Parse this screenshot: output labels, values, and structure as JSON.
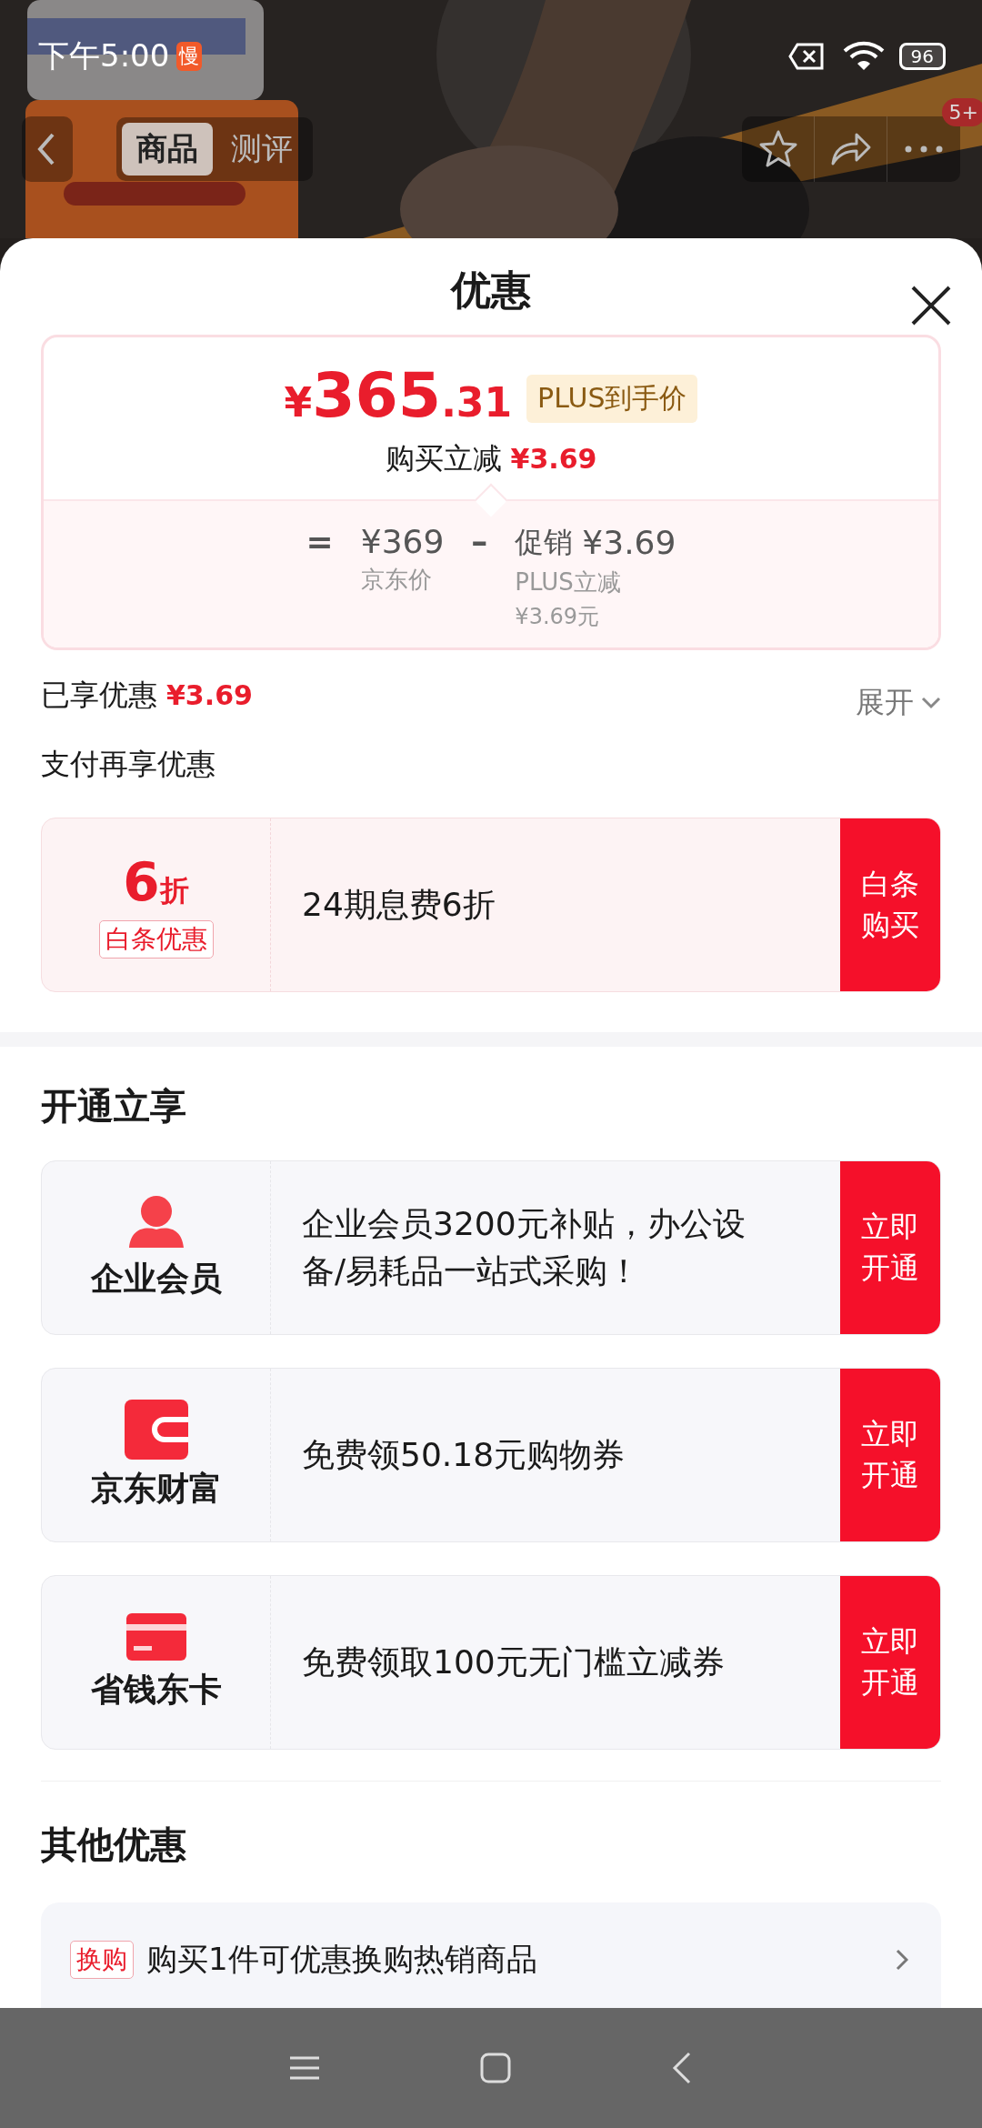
{
  "status_bar": {
    "time": "下午5:00",
    "badge": "慢",
    "battery": "96"
  },
  "nav": {
    "tabs": [
      {
        "label": "商品",
        "selected": true
      },
      {
        "label": "测评",
        "selected": false
      }
    ],
    "notification_badge": "5+"
  },
  "sheet": {
    "title": "优惠",
    "price_card": {
      "currency": "¥",
      "price_integer": "365",
      "price_decimal": ".31",
      "tag": "PLUS到手价",
      "instant_label": "购买立减",
      "instant_amount": "¥3.69",
      "equals": "=",
      "base_price": "¥369",
      "base_label": "京东价",
      "minus": "–",
      "promo_label": "促销",
      "promo_amount": "¥3.69",
      "promo_detail": "PLUS立减",
      "promo_detail_amount": "¥3.69元"
    },
    "enjoyed": {
      "label": "已享优惠",
      "amount": "¥3.69",
      "toggle": "展开",
      "expanded": false
    },
    "pay_section": {
      "title": "支付再享优惠",
      "offers": [
        {
          "kind": "discount",
          "value": "6",
          "unit": "折",
          "tag": "白条优惠",
          "text": "24期息费6折",
          "button": "白条购买"
        }
      ]
    },
    "open_section": {
      "title": "开通立享",
      "offers": [
        {
          "kind": "person",
          "name": "企业会员",
          "text": "企业会员3200元补贴，办公设备/易耗品一站式采购！",
          "button": "立即开通"
        },
        {
          "kind": "wallet",
          "name": "京东财富",
          "text": "免费领50.18元购物券",
          "button": "立即开通"
        },
        {
          "kind": "card",
          "name": "省钱东卡",
          "text": "免费领取100元无门槛立减券",
          "button": "立即开通"
        }
      ]
    },
    "other_section": {
      "title": "其他优惠",
      "items": [
        {
          "tag": "换购",
          "text": "购买1件可优惠换购热销商品"
        }
      ]
    }
  }
}
